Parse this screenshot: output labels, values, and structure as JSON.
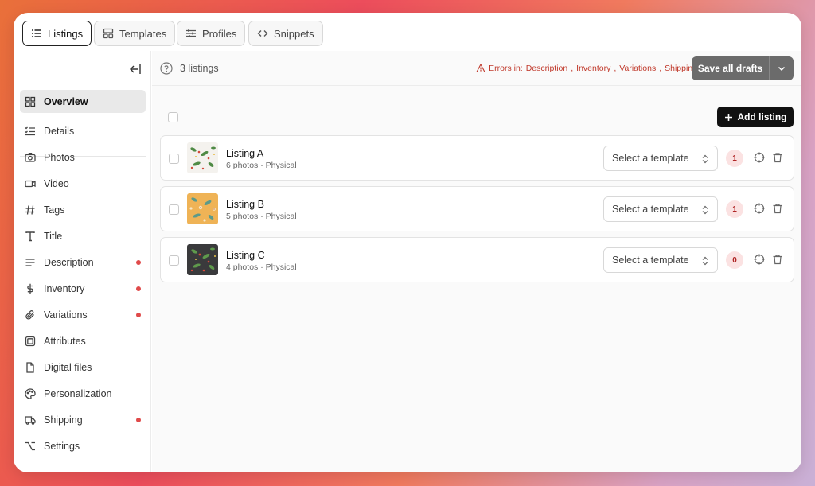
{
  "tabs": [
    {
      "label": "Listings",
      "icon": "list-icon",
      "active": true
    },
    {
      "label": "Templates",
      "icon": "template-icon"
    },
    {
      "label": "Profiles",
      "icon": "sliders-icon"
    },
    {
      "label": "Snippets",
      "icon": "code-icon"
    }
  ],
  "sidebar": {
    "items": [
      {
        "label": "Overview",
        "icon": "grid-icon",
        "active": true
      },
      {
        "label": "Details",
        "icon": "details-icon"
      },
      {
        "label": "Photos",
        "icon": "camera-icon"
      },
      {
        "label": "Video",
        "icon": "video-icon"
      },
      {
        "label": "Tags",
        "icon": "hash-icon"
      },
      {
        "label": "Title",
        "icon": "title-icon"
      },
      {
        "label": "Description",
        "icon": "text-lines-icon",
        "error": true
      },
      {
        "label": "Inventory",
        "icon": "dollar-icon",
        "error": true
      },
      {
        "label": "Variations",
        "icon": "paperclip-icon",
        "error": true
      },
      {
        "label": "Attributes",
        "icon": "cube-icon"
      },
      {
        "label": "Digital files",
        "icon": "file-icon"
      },
      {
        "label": "Personalization",
        "icon": "palette-icon"
      },
      {
        "label": "Shipping",
        "icon": "truck-icon",
        "error": true
      },
      {
        "label": "Settings",
        "icon": "option-icon"
      }
    ]
  },
  "header": {
    "count_text": "3 listings",
    "errors_prefix": "Errors in:",
    "error_links": [
      "Description",
      "Inventory",
      "Variations",
      "Shipping"
    ],
    "save_label": "Save all drafts",
    "add_label": "Add listing"
  },
  "listings": [
    {
      "title": "Listing A",
      "subtitle": "6 photos · Physical",
      "template_placeholder": "Select a template",
      "badge": "1"
    },
    {
      "title": "Listing B",
      "subtitle": "5 photos · Physical",
      "template_placeholder": "Select a template",
      "badge": "1"
    },
    {
      "title": "Listing C",
      "subtitle": "4 photos · Physical",
      "template_placeholder": "Select a template",
      "badge": "0"
    }
  ],
  "colors": {
    "error": "#c0392b",
    "dot": "#e04a4a",
    "primary": "#111111",
    "save": "#6b6b6b"
  }
}
